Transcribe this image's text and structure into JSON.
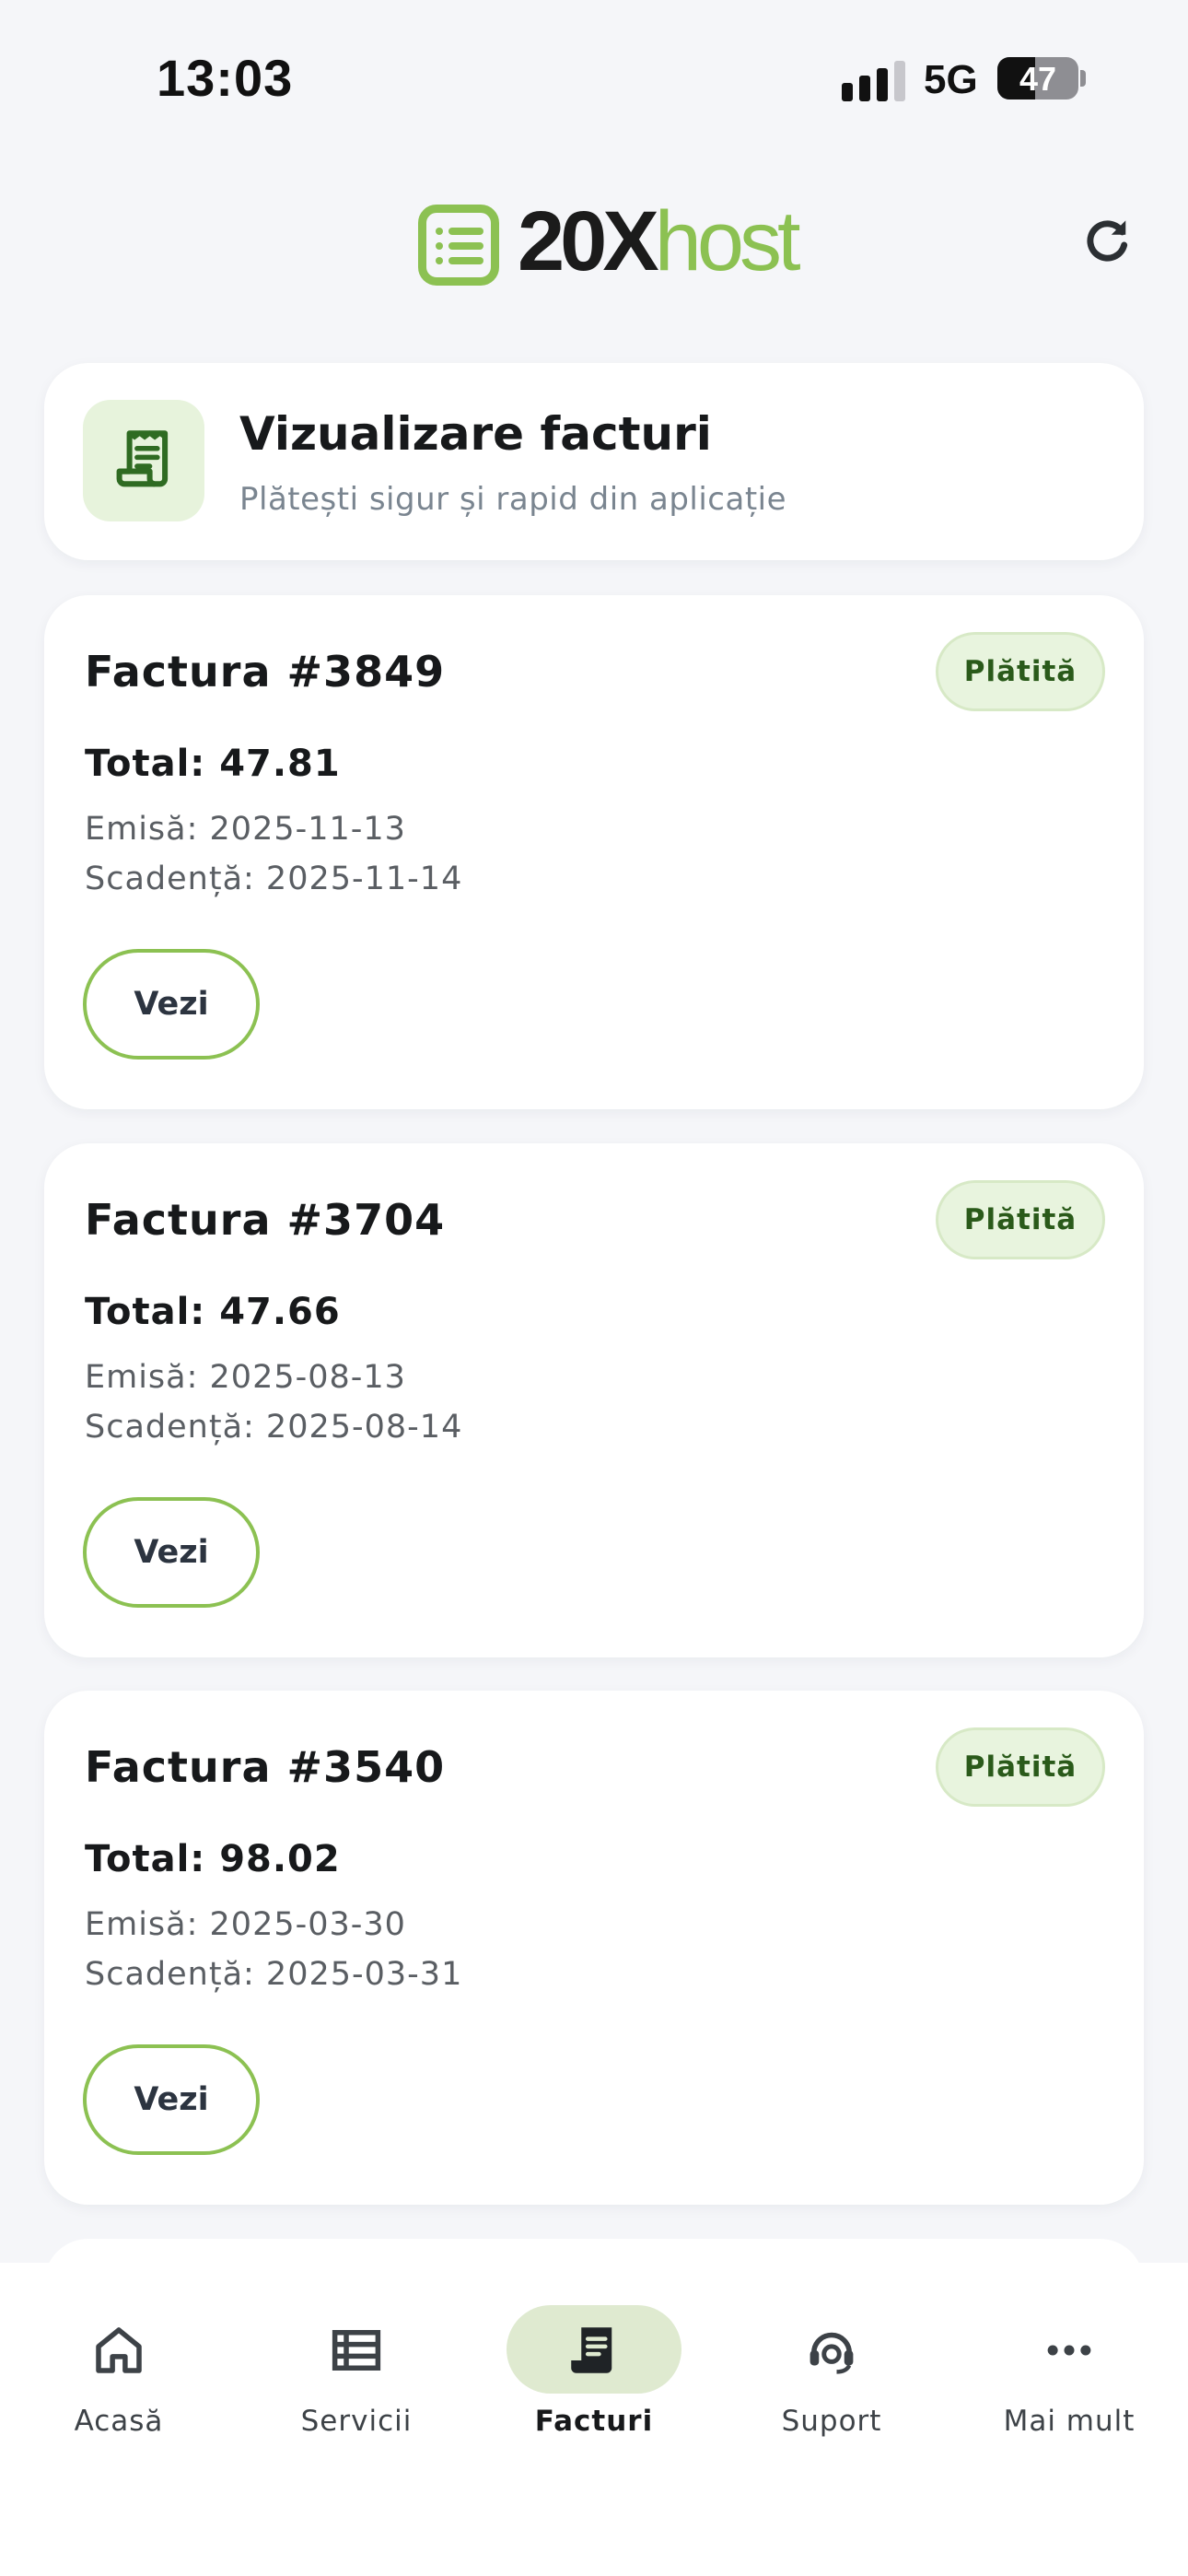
{
  "status": {
    "time": "13:03",
    "network": "5G",
    "battery": "47",
    "battery_fraction": 0.47
  },
  "header": {
    "logo_main": "20X",
    "logo_accent": "host"
  },
  "hero": {
    "title": "Vizualizare facturi",
    "subtitle": "Plătești sigur și rapid din aplicație"
  },
  "invoices": [
    {
      "title": "Factura #3849",
      "status": "Plătită",
      "total": "Total: 47.81",
      "issued": "Emisă: 2025-11-13",
      "due": "Scadență: 2025-11-14",
      "button": "Vezi"
    },
    {
      "title": "Factura #3704",
      "status": "Plătită",
      "total": "Total: 47.66",
      "issued": "Emisă: 2025-08-13",
      "due": "Scadență: 2025-08-14",
      "button": "Vezi"
    },
    {
      "title": "Factura #3540",
      "status": "Plătită",
      "total": "Total: 98.02",
      "issued": "Emisă: 2025-03-30",
      "due": "Scadență: 2025-03-31",
      "button": "Vezi"
    }
  ],
  "tabs": [
    {
      "label": "Acasă",
      "icon": "home-icon"
    },
    {
      "label": "Servicii",
      "icon": "list-icon"
    },
    {
      "label": "Facturi",
      "icon": "receipt-icon",
      "active": true
    },
    {
      "label": "Suport",
      "icon": "headset-icon"
    },
    {
      "label": "Mai mult",
      "icon": "more-icon"
    }
  ],
  "colors": {
    "accent": "#8cc152",
    "badge_bg": "#e8f4de",
    "badge_text": "#2a5a1a",
    "page_bg": "#f5f6f9"
  }
}
